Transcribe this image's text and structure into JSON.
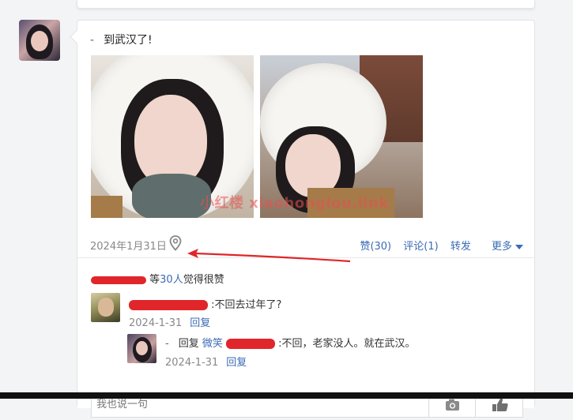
{
  "post": {
    "text": "到武汉了!",
    "dash": "-",
    "watermark": "小红楼 xiaohonglou.link",
    "date": "2024年1月31日",
    "actions": {
      "like": "赞(30)",
      "comment": "评论(1)",
      "share": "转发",
      "more": "更多"
    }
  },
  "likes": {
    "prefix": "等",
    "count": "30人",
    "suffix": "觉得很赞"
  },
  "comments": [
    {
      "text": ":不回去过年了?",
      "date": "2024-1-31",
      "reply_label": "回复"
    },
    {
      "dash": "-",
      "reply_word": "回复",
      "reply_to": "微笑",
      "text": ":不回，老家没人。就在武汉。",
      "date": "2024-1-31",
      "reply_label": "回复"
    }
  ],
  "input": {
    "placeholder": "我也说一句"
  },
  "colors": {
    "link": "#3b6bb5",
    "redaction": "#e0262a",
    "annotation_arrow": "#e0262a"
  },
  "icons": [
    "location-pin-icon",
    "camera-icon",
    "thumbs-up-icon",
    "caret-down-icon"
  ]
}
